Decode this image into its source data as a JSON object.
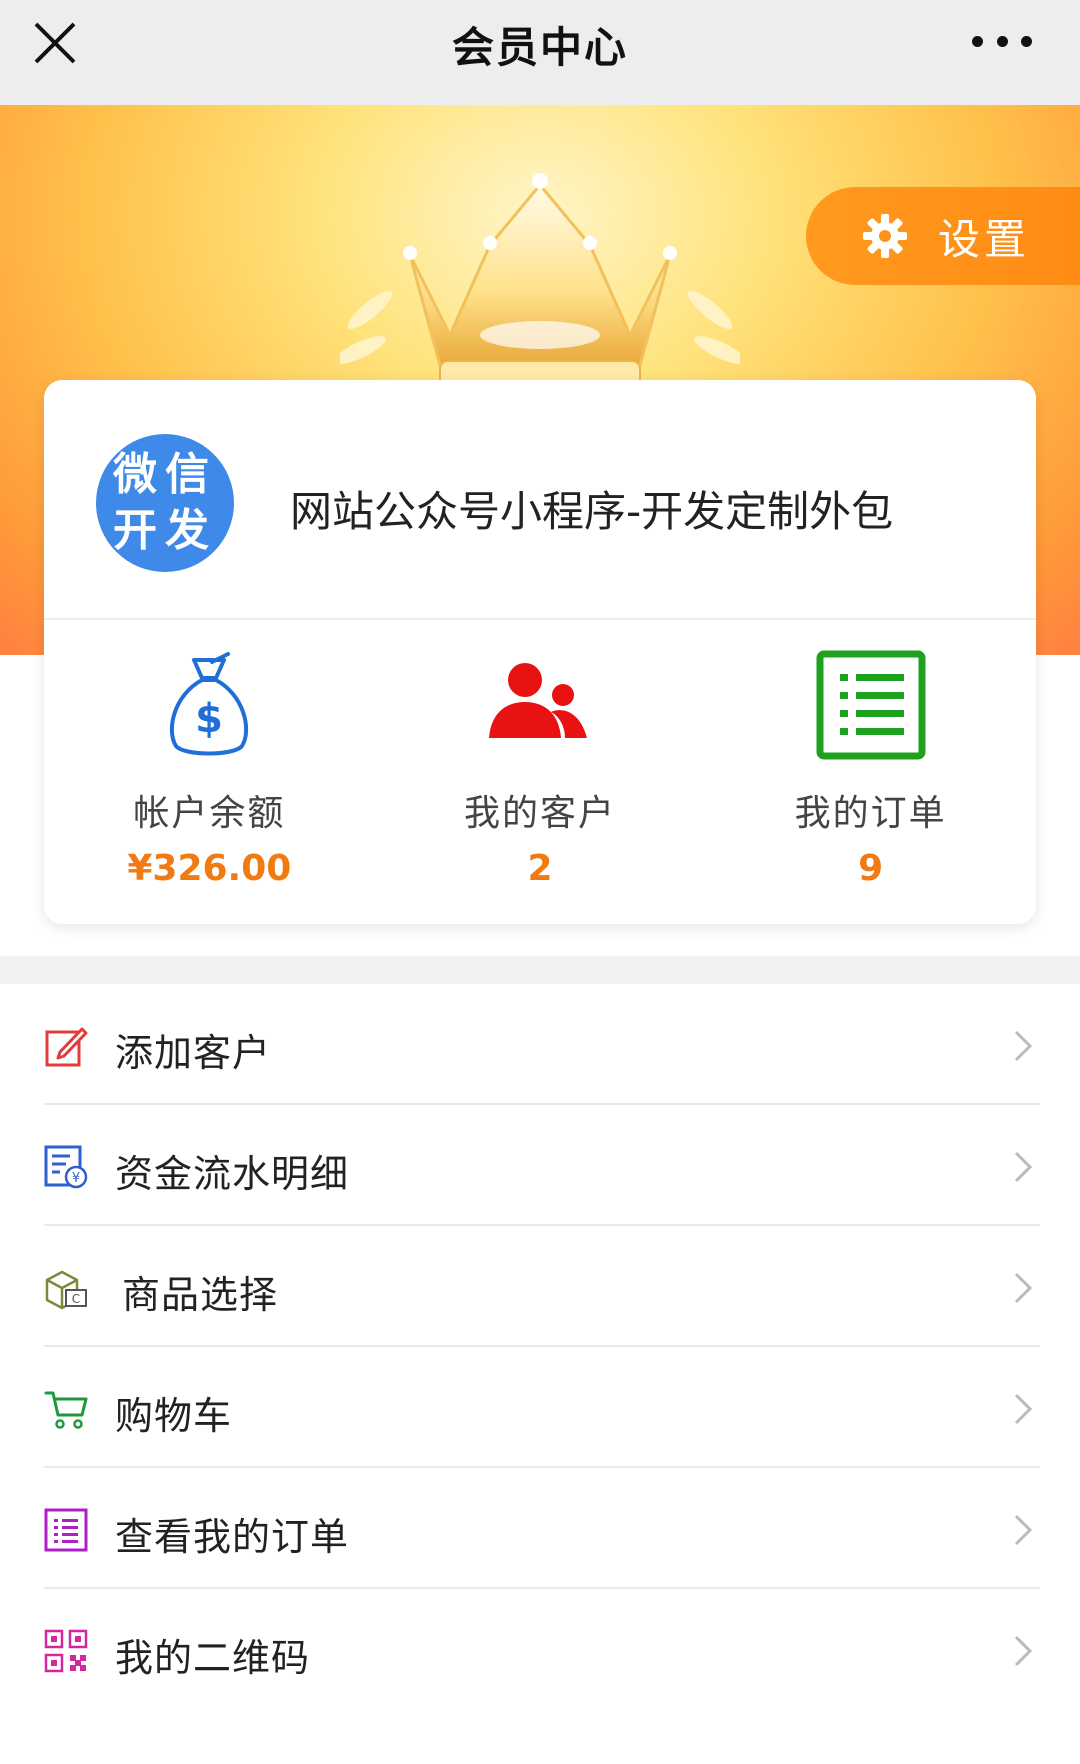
{
  "header": {
    "title": "会员中心"
  },
  "banner": {
    "settings_label": "设置"
  },
  "profile": {
    "avatar_line1": "微信",
    "avatar_line2": "开发",
    "name": "网站公众号小程序-开发定制外包"
  },
  "stats": [
    {
      "label": "帐户余额",
      "value": "¥326.00",
      "icon": "money-bag-icon",
      "color": "#1f6fd6"
    },
    {
      "label": "我的客户",
      "value": "2",
      "icon": "customers-icon",
      "color": "#e81212"
    },
    {
      "label": "我的订单",
      "value": "9",
      "icon": "order-list-icon",
      "color": "#1ea21e"
    }
  ],
  "menu": [
    {
      "label": "添加客户",
      "icon": "edit-icon",
      "color": "#e23b3b"
    },
    {
      "label": "资金流水明细",
      "icon": "bill-icon",
      "color": "#2f5fd0"
    },
    {
      "label": "商品选择",
      "icon": "goods-box-icon",
      "color": "#7a8a3a"
    },
    {
      "label": "购物车",
      "icon": "cart-icon",
      "color": "#1f9a3a"
    },
    {
      "label": "查看我的订单",
      "icon": "list-icon",
      "color": "#b21ec8"
    },
    {
      "label": "我的二维码",
      "icon": "qrcode-icon",
      "color": "#d4269e"
    }
  ],
  "colors": {
    "accent": "#f27a13",
    "nav_bg": "#ededed"
  }
}
